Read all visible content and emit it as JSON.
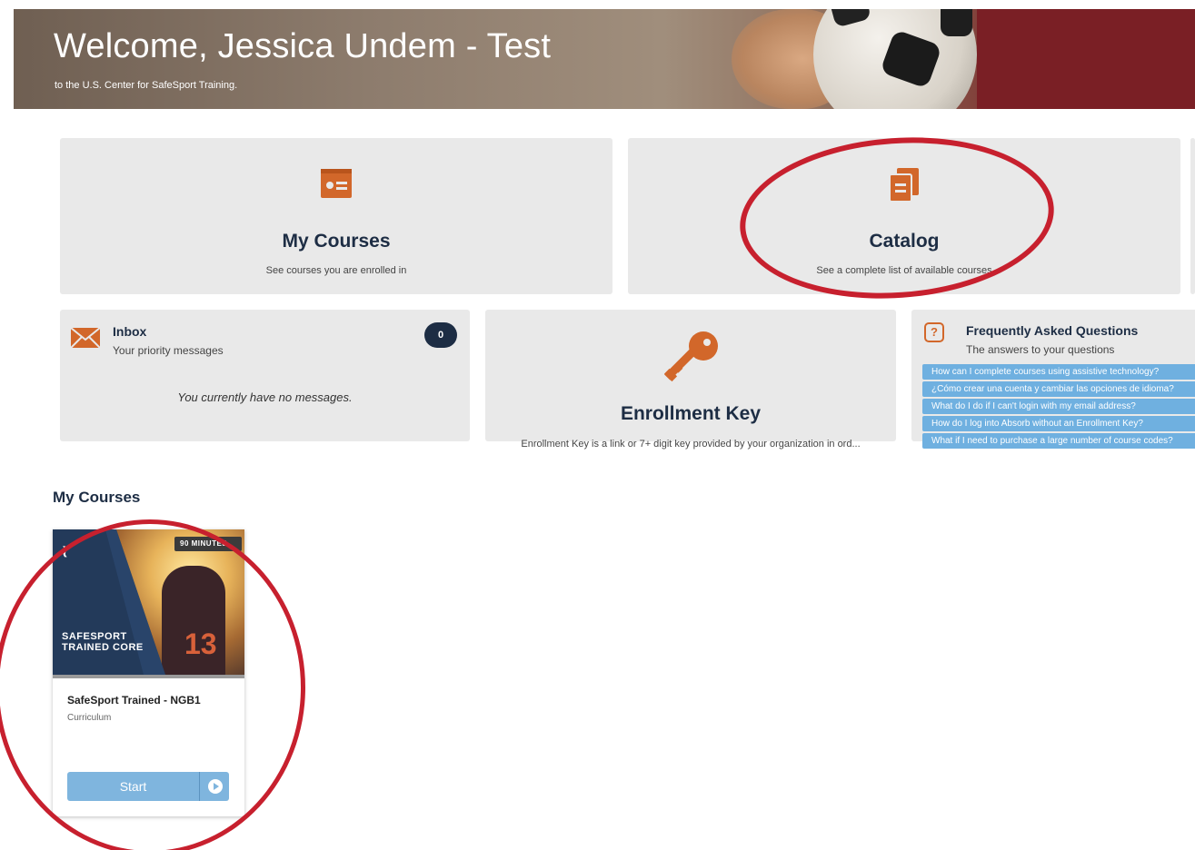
{
  "header": {
    "title": "Welcome, Jessica Undem - Test",
    "subtitle": "to the U.S. Center for SafeSport Training."
  },
  "tiles": {
    "my_courses": {
      "title": "My Courses",
      "description": "See courses you are enrolled in",
      "icon": "course-card-icon"
    },
    "catalog": {
      "title": "Catalog",
      "description": "See a complete list of available courses",
      "icon": "catalog-icon"
    },
    "inbox": {
      "title": "Inbox",
      "subtitle": "Your priority messages",
      "count": "0",
      "empty_message": "You currently have no messages.",
      "icon": "envelope-icon"
    },
    "enrollment_key": {
      "title": "Enrollment Key",
      "description": "Enrollment Key is a link or 7+ digit key provided by your organization in ord...",
      "icon": "key-icon"
    },
    "faq": {
      "title": "Frequently Asked Questions",
      "subtitle": "The answers to your questions",
      "icon": "question-icon",
      "items": [
        "How can I complete courses using assistive technology?",
        "¿Cómo crear una cuenta y cambiar las opciones de idioma?",
        "What do I do if I can't login with my email address?",
        "How do I log into Absorb without an Enrollment Key?",
        "What if I need to purchase a large number of course codes?"
      ]
    }
  },
  "my_courses_section": {
    "heading": "My Courses",
    "courses": [
      {
        "duration_badge": "90 MINUTES",
        "brand_text": "SAFESPORT TRAINED CORE",
        "jersey_number": "13",
        "title": "SafeSport Trained - NGB1",
        "type": "Curriculum",
        "button_label": "Start"
      }
    ]
  },
  "colors": {
    "accent_orange": "#d2672a",
    "navy": "#1d2d44",
    "tile_bg": "#e9e9e9",
    "faq_item_bg": "#6fb0e0",
    "button_blue": "#7fb5de",
    "annotation_red": "#c7202e"
  }
}
